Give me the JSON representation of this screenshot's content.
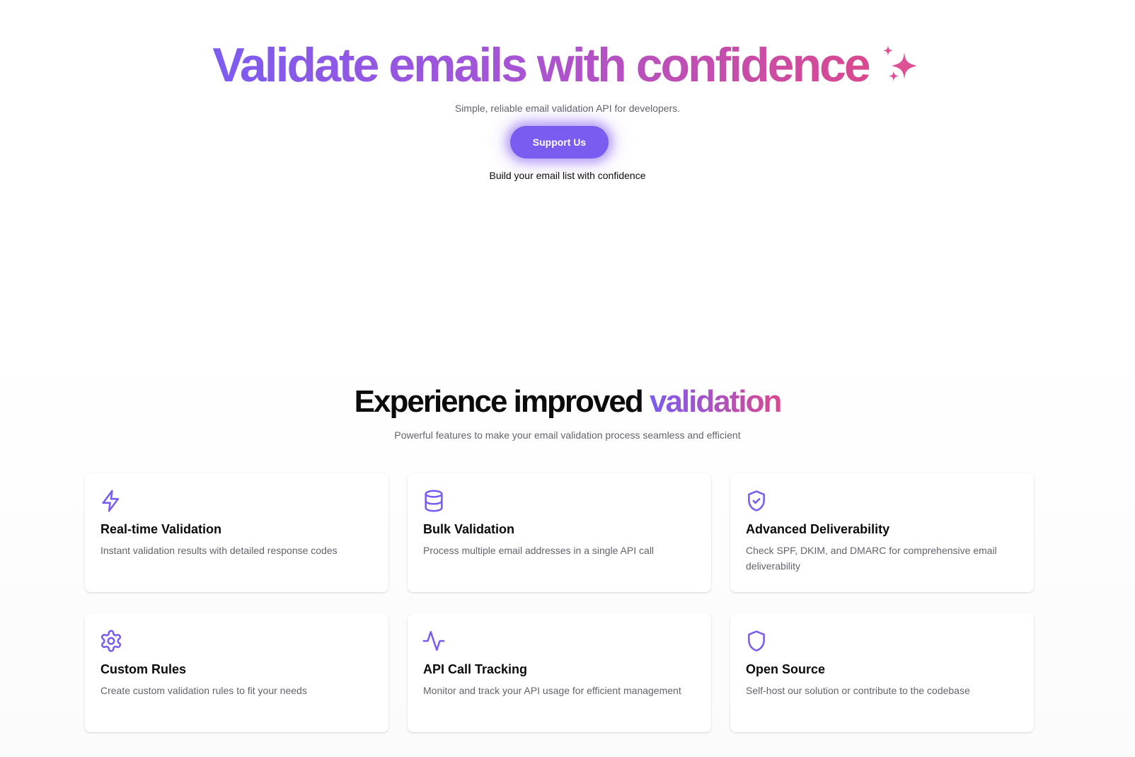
{
  "hero": {
    "title": "Validate emails with confidence",
    "title_icon": "sparkles-icon",
    "subtitle": "Simple, reliable email validation API for developers.",
    "cta_label": "Support Us",
    "tagline": "Build your email list with confidence"
  },
  "features": {
    "heading_prefix": "Experience improved",
    "heading_accent": "validation",
    "subtitle": "Powerful features to make your email validation process seamless and efficient",
    "items": [
      {
        "icon": "lightning-icon",
        "title": "Real-time Validation",
        "description": "Instant validation results with detailed response codes"
      },
      {
        "icon": "database-icon",
        "title": "Bulk Validation",
        "description": "Process multiple email addresses in a single API call"
      },
      {
        "icon": "shield-check-icon",
        "title": "Advanced Deliverability",
        "description": "Check SPF, DKIM, and DMARC for comprehensive email deliverability"
      },
      {
        "icon": "gear-icon",
        "title": "Custom Rules",
        "description": "Create custom validation rules to fit your needs"
      },
      {
        "icon": "activity-icon",
        "title": "API Call Tracking",
        "description": "Monitor and track your API usage for efficient management"
      },
      {
        "icon": "shield-icon",
        "title": "Open Source",
        "description": "Self-host our solution or contribute to the codebase"
      }
    ]
  },
  "colors": {
    "accent_purple": "#7a5cf0",
    "accent_pink": "#d9498f",
    "muted_text": "#63636e"
  }
}
